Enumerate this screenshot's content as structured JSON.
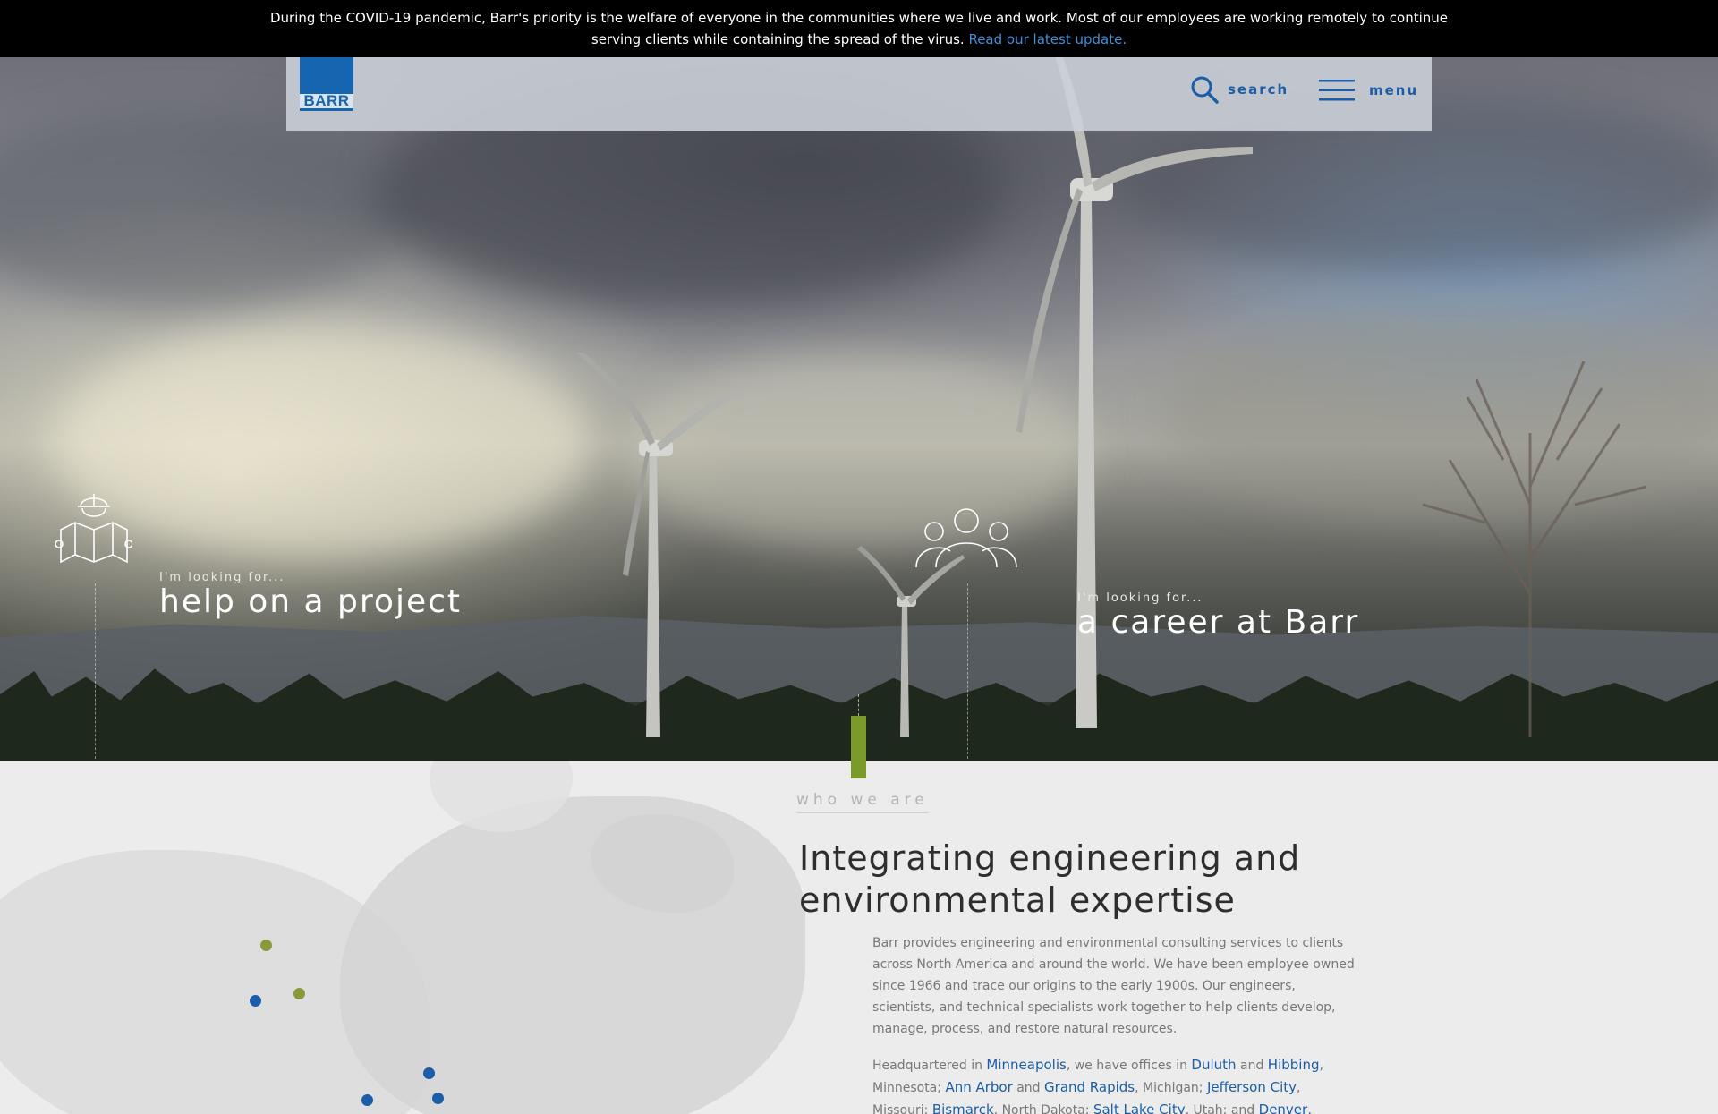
{
  "banner": {
    "text": "During the COVID-19 pandemic, Barr's priority is the welfare of everyone in the communities where we live and work. Most of our employees are working remotely to continue serving clients while containing the spread of the virus.",
    "link_label": "Read our latest update."
  },
  "header": {
    "logo_text": "BARR",
    "search_label": "search",
    "menu_label": "menu"
  },
  "hero": {
    "cta_project": {
      "pre": "I'm looking for...",
      "main": "help on a project"
    },
    "cta_career": {
      "pre": "I'm looking for...",
      "main": "a career at Barr"
    }
  },
  "who": {
    "section_label": "who we are",
    "heading": "Integrating engineering and environmental expertise",
    "paragraph1": "Barr provides engineering and environmental consulting services to clients across North America and around the world. We have been employee owned since 1966 and trace our origins to the early 1900s. Our engineers, scientists, and technical specialists work together to help clients develop, manage, process, and restore natural resources.",
    "p2": {
      "t1": "Headquartered in ",
      "minneapolis": "Minneapolis",
      "t2": ", we have offices in ",
      "duluth": "Duluth",
      "t3": " and ",
      "hibbing": "Hibbing",
      "t4": ", Minnesota; ",
      "ann_arbor": "Ann Arbor",
      "t5": " and ",
      "grand_rapids": "Grand Rapids",
      "t6": ", Michigan; ",
      "jefferson_city": "Jefferson City",
      "t7": ", Missouri; ",
      "bismarck": "Bismarck",
      "t8": ", North Dakota; ",
      "salt_lake_city": "Salt Lake City",
      "t9": ", Utah; and ",
      "denver": "Denver,"
    }
  },
  "colors": {
    "brand_blue": "#1565b0",
    "accent_green": "#7a9a2a",
    "link_blue": "#1b5da8"
  },
  "map_dots": [
    {
      "color": "green"
    },
    {
      "color": "green"
    },
    {
      "color": "blue"
    },
    {
      "color": "blue"
    },
    {
      "color": "blue"
    },
    {
      "color": "blue"
    }
  ]
}
